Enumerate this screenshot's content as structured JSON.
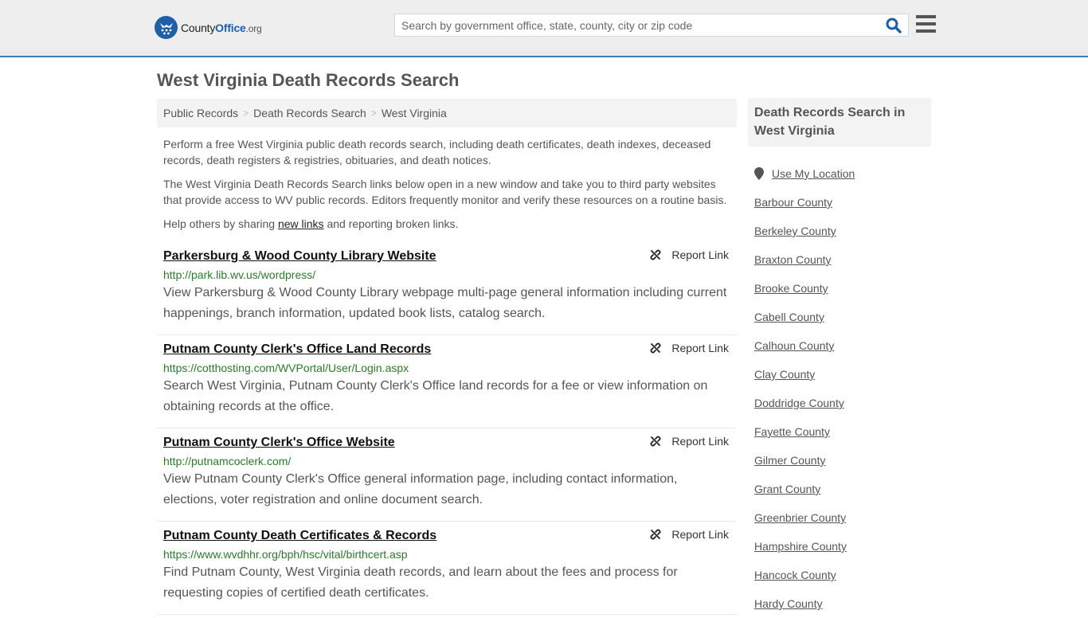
{
  "header": {
    "logo": {
      "part1": "County",
      "part2": "Office",
      "part3": ".org"
    },
    "search_placeholder": "Search by government office, state, county, city or zip code",
    "search_value": "",
    "accent_color": "#1f5fa8"
  },
  "page": {
    "title": "West Virginia Death Records Search",
    "breadcrumb": [
      "Public Records",
      "Death Records Search",
      "West Virginia"
    ],
    "intro": [
      "Perform a free West Virginia public death records search, including death certificates, death indexes, deceased records, death registers & registries, obituaries, and death notices.",
      "The West Virginia Death Records Search links below open in a new window and take you to third party websites that provide access to WV public records. Editors frequently monitor and verify these resources on a routine basis."
    ],
    "help": {
      "prefix": "Help others by sharing ",
      "link": "new links",
      "suffix": " and reporting broken links."
    }
  },
  "results": [
    {
      "title": "Parkersburg & Wood County Library Website",
      "url": "http://park.lib.wv.us/wordpress/",
      "description": "View Parkersburg & Wood County Library webpage multi-page general information including current happenings, branch information, updated book lists, catalog search.",
      "report_label": "Report Link"
    },
    {
      "title": "Putnam County Clerk's Office Land Records",
      "url": "https://cotthosting.com/WVPortal/User/Login.aspx",
      "description": "Search West Virginia, Putnam County Clerk's Office land records for a fee or view information on obtaining records at the office.",
      "report_label": "Report Link"
    },
    {
      "title": "Putnam County Clerk's Office Website",
      "url": "http://putnamcoclerk.com/",
      "description": "View Putnam County Clerk's Office general information page, including contact information, elections, voter registration and online document search.",
      "report_label": "Report Link"
    },
    {
      "title": "Putnam County Death Certificates & Records",
      "url": "https://www.wvdhhr.org/bph/hsc/vital/birthcert.asp",
      "description": "Find Putnam County, West Virginia death records, and learn about the fees and process for requesting copies of certified death certificates.",
      "report_label": "Report Link"
    }
  ],
  "sidebar": {
    "heading": "Death Records Search in West Virginia",
    "use_location": "Use My Location",
    "counties": [
      "Barbour County",
      "Berkeley County",
      "Braxton County",
      "Brooke County",
      "Cabell County",
      "Calhoun County",
      "Clay County",
      "Doddridge County",
      "Fayette County",
      "Gilmer County",
      "Grant County",
      "Greenbrier County",
      "Hampshire County",
      "Hancock County",
      "Hardy County"
    ]
  }
}
